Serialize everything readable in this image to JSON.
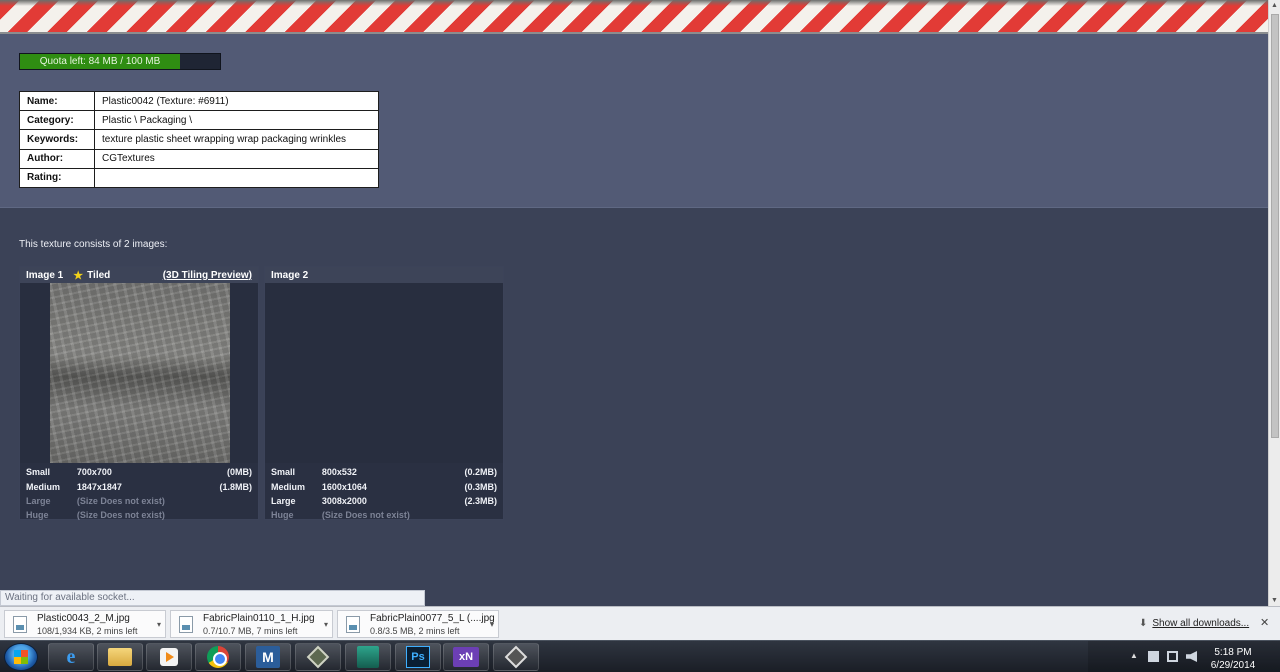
{
  "quota": {
    "label": "Quota left: 84 MB / 100 MB",
    "used_fraction": 0.7
  },
  "info": [
    {
      "key": "Name:",
      "value": "Plastic0042 (Texture: #6911)"
    },
    {
      "key": "Category:",
      "value": "Plastic \\ Packaging \\"
    },
    {
      "key": "Keywords:",
      "value": "texture plastic sheet wrapping wrap packaging wrinkles"
    },
    {
      "key": "Author:",
      "value": "CGTextures"
    },
    {
      "key": "Rating:",
      "value": ""
    }
  ],
  "consists_text": "This texture consists of 2 images:",
  "images": [
    {
      "title": "Image 1",
      "tiled_label": "Tiled",
      "preview_link": "(3D Tiling Preview)",
      "sizes": [
        {
          "name": "Small",
          "dims": "700x700",
          "size": "(0MB)"
        },
        {
          "name": "Medium",
          "dims": "1847x1847",
          "size": "(1.8MB)"
        },
        {
          "name": "Large",
          "dims": "(Size Does not exist)",
          "size": ""
        },
        {
          "name": "Huge",
          "dims": "(Size Does not exist)",
          "size": ""
        }
      ]
    },
    {
      "title": "Image 2",
      "sizes": [
        {
          "name": "Small",
          "dims": "800x532",
          "size": "(0.2MB)"
        },
        {
          "name": "Medium",
          "dims": "1600x1064",
          "size": "(0.3MB)"
        },
        {
          "name": "Large",
          "dims": "3008x2000",
          "size": "(2.3MB)"
        },
        {
          "name": "Huge",
          "dims": "(Size Does not exist)",
          "size": ""
        }
      ]
    }
  ],
  "status_bubble": "Waiting for available socket...",
  "downloads": [
    {
      "name": "Plastic0043_2_M.jpg",
      "status": "108/1,934 KB, 2 mins left"
    },
    {
      "name": "FabricPlain0110_1_H.jpg",
      "status": "0.7/10.7 MB, 7 mins left"
    },
    {
      "name": "FabricPlain0077_5_L (....jpg",
      "status": "0.8/3.5 MB, 2 mins left"
    }
  ],
  "show_all_label": "Show all downloads...",
  "taskbar": {
    "apps": [
      "start-orb-icon",
      "internet-explorer-icon",
      "folder-icon",
      "media-player-icon",
      "chrome-icon",
      "m-app-icon",
      "diamond-app-icon",
      "green-app-icon",
      "photoshop-icon",
      "xnview-icon",
      "tool-app-icon"
    ],
    "m_label": "M",
    "ps_label": "Ps",
    "xn_label": "xN",
    "time": "5:18 PM",
    "date": "6/29/2014"
  },
  "colors": {
    "page_bg": "#3b4257",
    "panel_bg": "#525a75",
    "quota_fill": "#2f8d12",
    "star": "#f2d21a"
  }
}
